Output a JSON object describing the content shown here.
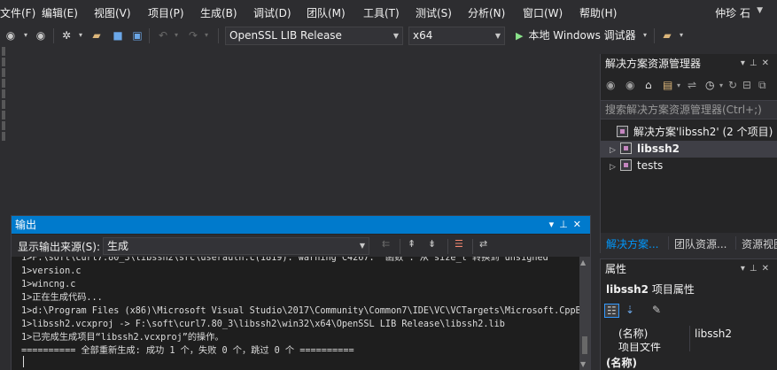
{
  "menubar": {
    "items": [
      "文件(F)",
      "编辑(E)",
      "视图(V)",
      "项目(P)",
      "生成(B)",
      "调试(D)",
      "团队(M)",
      "工具(T)",
      "测试(S)",
      "分析(N)",
      "窗口(W)",
      "帮助(H)"
    ],
    "user": "仲珍 石"
  },
  "toolbar": {
    "configuration": "OpenSSL LIB Release",
    "platform": "x64",
    "run_label": "本地 Windows 调试器"
  },
  "output": {
    "title": "输出",
    "source_label": "显示输出来源(S):",
    "source_value": "生成",
    "lines": [
      "1>F:\\soft\\curl7.80_3\\libssh2\\src\\userauth.c(1819): warning C4267: “函数”: 从“size_t”转换到“unsigned",
      "1>version.c",
      "1>wincng.c",
      "1>正在生成代码...",
      "1>d:\\Program Files (x86)\\Microsoft Visual Studio\\2017\\Community\\Common7\\IDE\\VC\\VCTargets\\Microsoft.CppBui",
      "1>libssh2.vcxproj -> F:\\soft\\curl7.80_3\\libssh2\\win32\\x64\\OpenSSL LIB Release\\libssh2.lib",
      "1>已完成生成项目“libssh2.vcxproj”的操作。",
      "========== 全部重新生成: 成功 1 个，失败 0 个，跳过 0 个 =========="
    ]
  },
  "solution_explorer": {
    "title": "解决方案资源管理器",
    "search_placeholder": "搜索解决方案资源管理器(Ctrl+;)",
    "solution_label": "解决方案'libssh2' (2 个项目)",
    "projects": [
      "libssh2",
      "tests"
    ],
    "tabs": [
      "解决方案...",
      "团队资源...",
      "资源视图"
    ]
  },
  "properties": {
    "title": "属性",
    "object_name": "libssh2",
    "object_type": "项目属性",
    "rows": [
      {
        "name": "(名称)",
        "value": "libssh2"
      },
      {
        "name": "项目文件",
        "value": ""
      }
    ],
    "category": "(名称)"
  },
  "icons": [
    "back-icon",
    "forward-icon",
    "new-project-icon",
    "open-icon",
    "save-icon",
    "save-all-icon",
    "undo-icon",
    "redo-icon",
    "play-icon",
    "find-icon",
    "pin-icon",
    "close-icon",
    "home-icon",
    "sync-icon",
    "history-icon",
    "collapse-icon",
    "wrench-icon"
  ],
  "colors": {
    "accent": "#007acc",
    "background": "#2d2d30",
    "panel": "#252526",
    "editor": "#1e1e1e",
    "run": "#8ae28a",
    "active_tab": "#0097fb"
  }
}
